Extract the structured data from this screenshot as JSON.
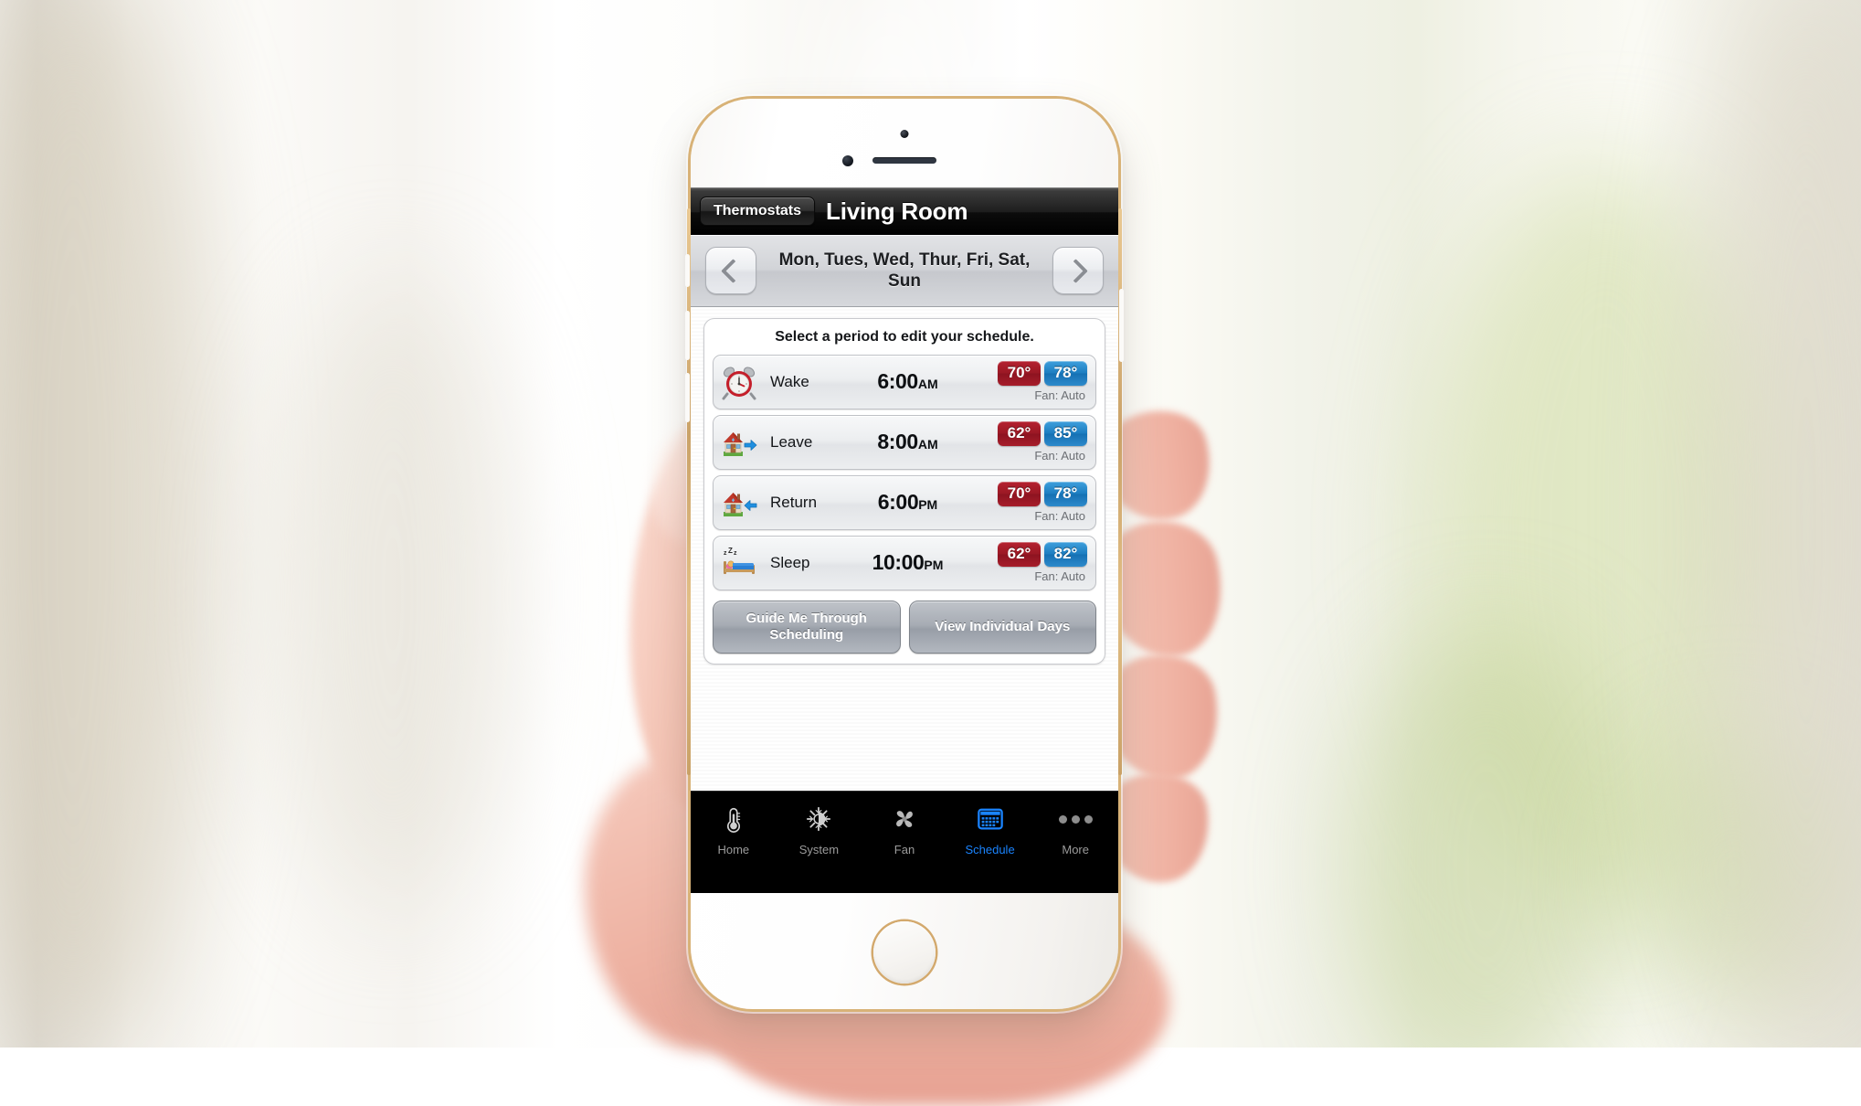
{
  "navbar": {
    "back_label": "Thermostats",
    "title": "Living Room"
  },
  "daybar": {
    "prev_icon": "chevron-left-icon",
    "next_icon": "chevron-right-icon",
    "days_label": "Mon, Tues, Wed, Thur, Fri, Sat, Sun"
  },
  "schedule_card": {
    "instruction": "Select a period to edit your schedule.",
    "periods": [
      {
        "icon": "alarm-clock-icon",
        "name": "Wake",
        "time": "6:00",
        "ampm": "AM",
        "heat": "70°",
        "cool": "78°",
        "fan": "Fan: Auto"
      },
      {
        "icon": "house-leave-icon",
        "name": "Leave",
        "time": "8:00",
        "ampm": "AM",
        "heat": "62°",
        "cool": "85°",
        "fan": "Fan: Auto"
      },
      {
        "icon": "house-return-icon",
        "name": "Return",
        "time": "6:00",
        "ampm": "PM",
        "heat": "70°",
        "cool": "78°",
        "fan": "Fan: Auto"
      },
      {
        "icon": "bed-sleep-icon",
        "name": "Sleep",
        "time": "10:00",
        "ampm": "PM",
        "heat": "62°",
        "cool": "82°",
        "fan": "Fan: Auto"
      }
    ],
    "actions": {
      "guide": "Guide Me Through Scheduling",
      "individual_days": "View Individual Days"
    }
  },
  "tabbar": {
    "tabs": [
      {
        "label": "Home",
        "icon": "thermometer-icon",
        "active": false
      },
      {
        "label": "System",
        "icon": "sun-snowflake-icon",
        "active": false
      },
      {
        "label": "Fan",
        "icon": "fan-blade-icon",
        "active": false
      },
      {
        "label": "Schedule",
        "icon": "calendar-icon",
        "active": true
      },
      {
        "label": "More",
        "icon": "ellipsis-icon",
        "active": false
      }
    ]
  },
  "colors": {
    "heat_badge": "#9a1824",
    "cool_badge": "#1b7cc0",
    "tab_active": "#1a84ff",
    "navbar_bg": "#000000"
  }
}
